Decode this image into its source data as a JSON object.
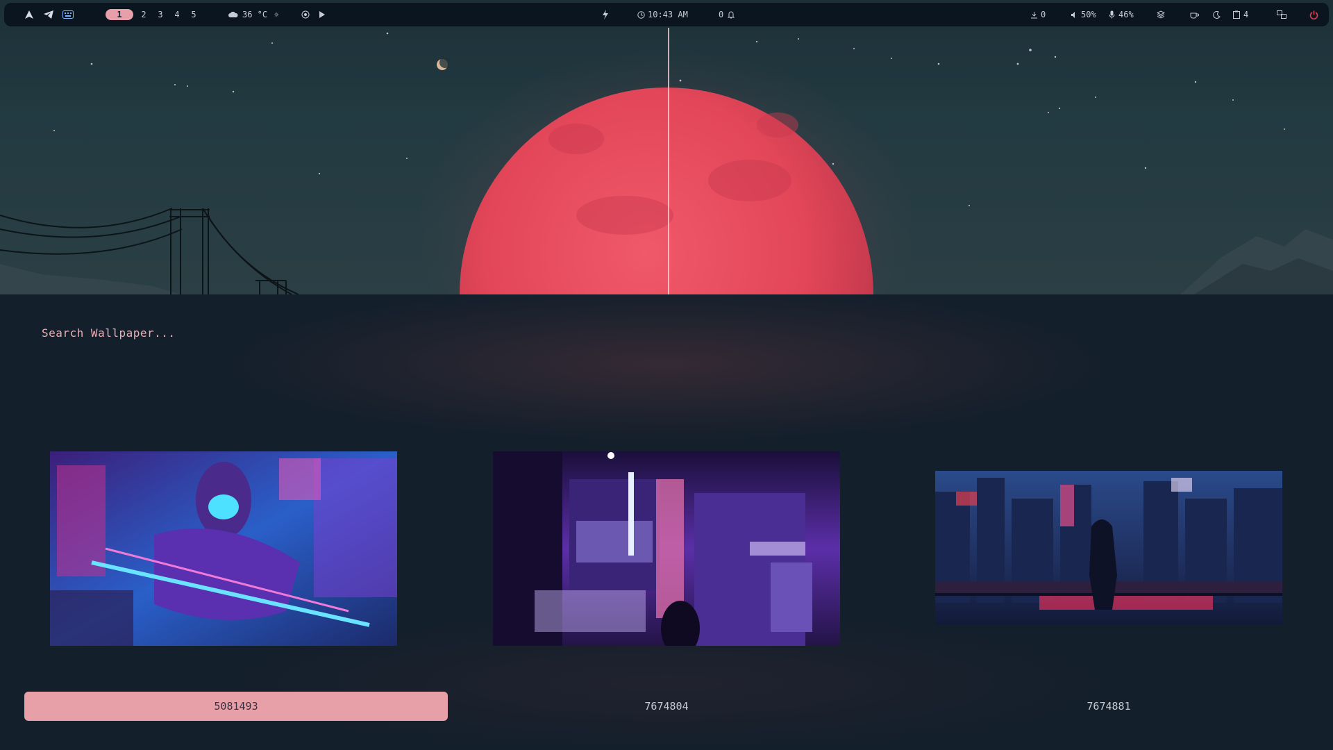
{
  "topbar": {
    "left_icons": [
      "arch-icon",
      "telegram-icon",
      "keyboard-icon"
    ],
    "workspaces": [
      {
        "label": "1",
        "active": true
      },
      {
        "label": "2",
        "active": false
      },
      {
        "label": "3",
        "active": false
      },
      {
        "label": "4",
        "active": false
      },
      {
        "label": "5",
        "active": false
      }
    ],
    "weather": {
      "icon": "cloud-icon",
      "text": "36 °C",
      "extra_icon": "sun-icon"
    },
    "media": {
      "icons": [
        "media-record-icon",
        "play-icon"
      ]
    },
    "power_profile_icon": "lightning-icon",
    "clock": {
      "icon": "clock-icon",
      "text": "10:43 AM"
    },
    "notifications": {
      "count": "0",
      "icon": "bell-icon"
    },
    "updates": {
      "icon": "download-icon",
      "count": "0"
    },
    "volume": {
      "icon": "speaker-icon",
      "text": "50%"
    },
    "mic": {
      "icon": "microphone-icon",
      "text": "46%"
    },
    "right_icons": [
      "layers-icon",
      "coffee-icon",
      "moon-icon"
    ],
    "clipboard": {
      "icon": "clipboard-icon",
      "count": "4"
    },
    "layout_icon": "window-layout-icon",
    "power_icon": "power-icon",
    "accent": "#e7a0aa",
    "power_color": "#e0404a"
  },
  "launcher": {
    "search_placeholder": "Search Wallpaper...",
    "items": [
      {
        "label": "5081493",
        "selected": true
      },
      {
        "label": "7674804",
        "selected": false
      },
      {
        "label": "7674881",
        "selected": false
      }
    ],
    "selected_color": "#e8a0a8"
  }
}
